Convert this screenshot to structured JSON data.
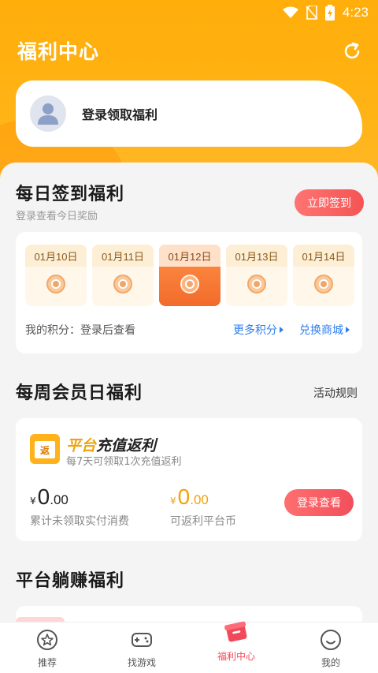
{
  "status_bar": {
    "time": "4:23"
  },
  "header": {
    "title": "福利中心",
    "refresh_icon": "refresh-icon"
  },
  "login_card": {
    "text": "登录领取福利",
    "avatar_icon": "user-avatar-icon"
  },
  "daily_signin": {
    "title": "每日签到福利",
    "subtitle": "登录查看今日奖励",
    "button": "立即签到",
    "days": [
      {
        "date": "01月10日",
        "active": false
      },
      {
        "date": "01月11日",
        "active": false
      },
      {
        "date": "01月12日",
        "active": true
      },
      {
        "date": "01月13日",
        "active": false
      },
      {
        "date": "01月14日",
        "active": false
      }
    ],
    "points_label": "我的积分：登录后查看",
    "more_points": "更多积分",
    "exchange_mall": "兑换商城"
  },
  "weekly_member": {
    "title": "每周会员日福利",
    "rules": "活动规则",
    "card": {
      "logo_char": "返",
      "title_prefix": "平台",
      "title_highlight": "充值返利",
      "subtitle": "每7天可领取1次充值返利",
      "left_currency": "¥",
      "left_big": "0",
      "left_small": ".00",
      "left_caption": "累计未领取实付消费",
      "right_currency": "¥",
      "right_big": "0",
      "right_small": ".00",
      "right_caption": "可返利平台币",
      "button": "登录查看"
    }
  },
  "lie_earn": {
    "title": "平台躺赚福利"
  },
  "tabbar": [
    {
      "label": "推荐",
      "icon": "star-icon",
      "active": false
    },
    {
      "label": "找游戏",
      "icon": "gamepad-icon",
      "active": false
    },
    {
      "label": "福利中心",
      "icon": "gift-icon",
      "active": true
    },
    {
      "label": "我的",
      "icon": "smiley-icon",
      "active": false
    }
  ],
  "colors": {
    "header": "#ffae0a",
    "accent_red": "#f04a5a",
    "link_blue": "#2d7ef0",
    "rebate_orange": "#f0a30a"
  }
}
